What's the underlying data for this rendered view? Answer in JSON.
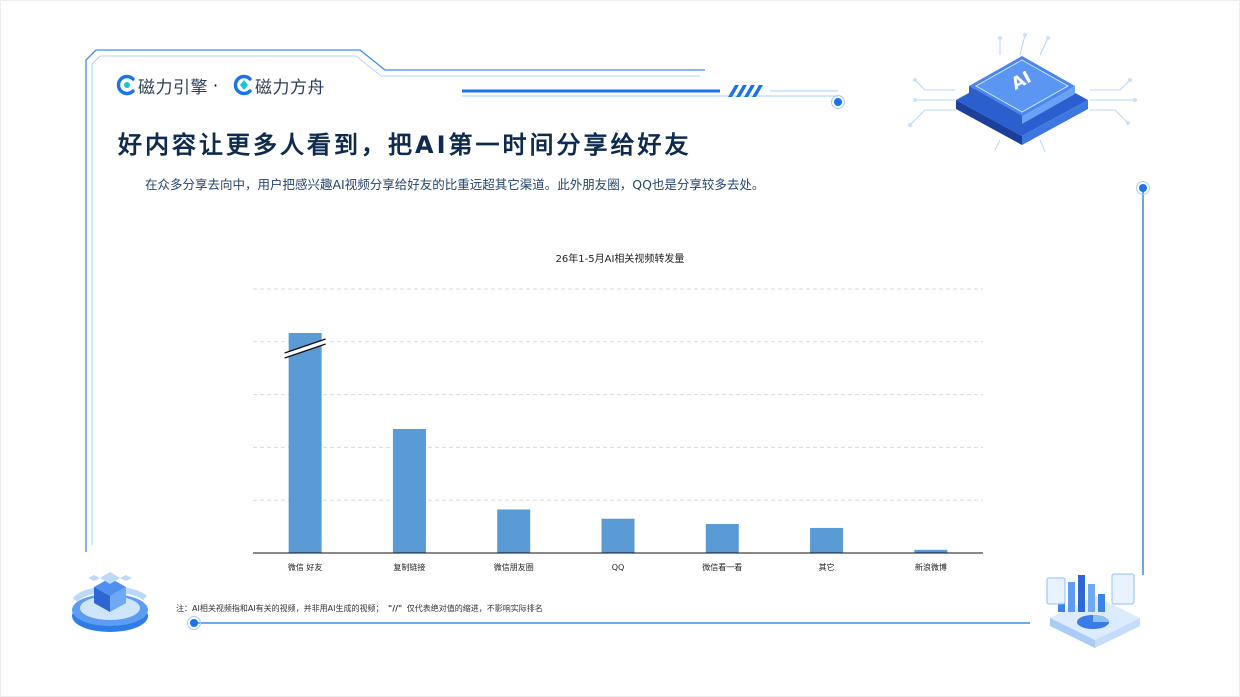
{
  "brand": {
    "logo1_text": "磁力引擎",
    "separator": "·",
    "logo2_text": "磁力方舟"
  },
  "header": {
    "title": "好内容让更多人看到，把AI第一时间分享给好友",
    "subtitle": "在众多分享去向中，用户把感兴趣AI视频分享给好友的比重远超其它渠道。此外朋友圈，QQ也是分享较多去处。"
  },
  "illustrations": {
    "chip_label": "AI"
  },
  "footnote": {
    "prefix": "注：AI相关视频指和AI有关的视频，并非用AI生成的视频；",
    "break_symbol": "\"//\"",
    "suffix": "仅代表绝对值的缩进，不影响实际排名"
  },
  "colors": {
    "bar": "#5b9bd5",
    "accent": "#1a73e8",
    "title": "#0e2a4e"
  },
  "chart_data": {
    "type": "bar",
    "title": "26年1-5月AI相关视频转发量",
    "categories": [
      "微信 好友",
      "复制链接",
      "微信朋友圈",
      "QQ",
      "微信看一看",
      "其它",
      "新浪微博"
    ],
    "values": [
      100,
      47,
      16.5,
      13,
      11,
      9.5,
      1.2
    ],
    "axis_break_on": "微信 好友",
    "xlabel": "",
    "ylabel": "",
    "y_tick_labels_shown": false,
    "grid": true,
    "legend": "none"
  }
}
